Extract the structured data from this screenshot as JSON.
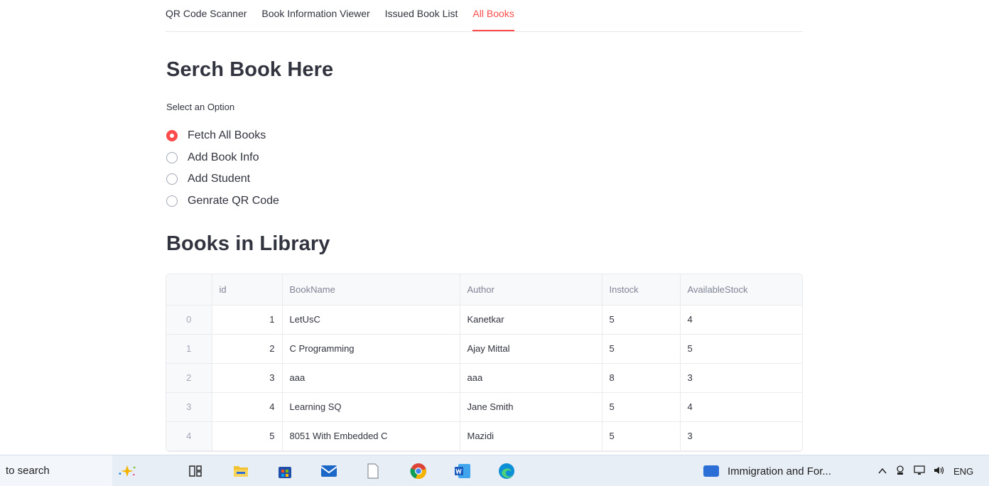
{
  "tabs": [
    {
      "label": "QR Code Scanner",
      "active": false
    },
    {
      "label": "Book Information Viewer",
      "active": false
    },
    {
      "label": "Issued Book List",
      "active": false
    },
    {
      "label": "All Books",
      "active": true
    }
  ],
  "search_section": {
    "title": "Serch Book Here",
    "radio_label": "Select an Option",
    "options": [
      {
        "label": "Fetch All Books",
        "checked": true
      },
      {
        "label": "Add Book Info",
        "checked": false
      },
      {
        "label": "Add Student",
        "checked": false
      },
      {
        "label": "Genrate QR Code",
        "checked": false
      }
    ]
  },
  "library_section": {
    "title": "Books in Library",
    "table": {
      "columns": [
        "",
        "id",
        "BookName",
        "Author",
        "Instock",
        "AvailableStock"
      ],
      "rows": [
        [
          "0",
          "1",
          "LetUsC",
          "Kanetkar",
          "5",
          "4"
        ],
        [
          "1",
          "2",
          "C Programming",
          "Ajay Mittal",
          "5",
          "5"
        ],
        [
          "2",
          "3",
          "aaa",
          "aaa",
          "8",
          "3"
        ],
        [
          "3",
          "4",
          "Learning SQ",
          "Jane Smith",
          "5",
          "4"
        ],
        [
          "4",
          "5",
          "8051 With Embedded C",
          "Mazidi",
          "5",
          "3"
        ]
      ]
    }
  },
  "taskbar": {
    "search_text": "to search",
    "running_app": "Immigration and For...",
    "tray_text": "ENG",
    "colors": {
      "accent": "#ff4b4b",
      "taskbar_bg": "#e8eef6"
    }
  }
}
